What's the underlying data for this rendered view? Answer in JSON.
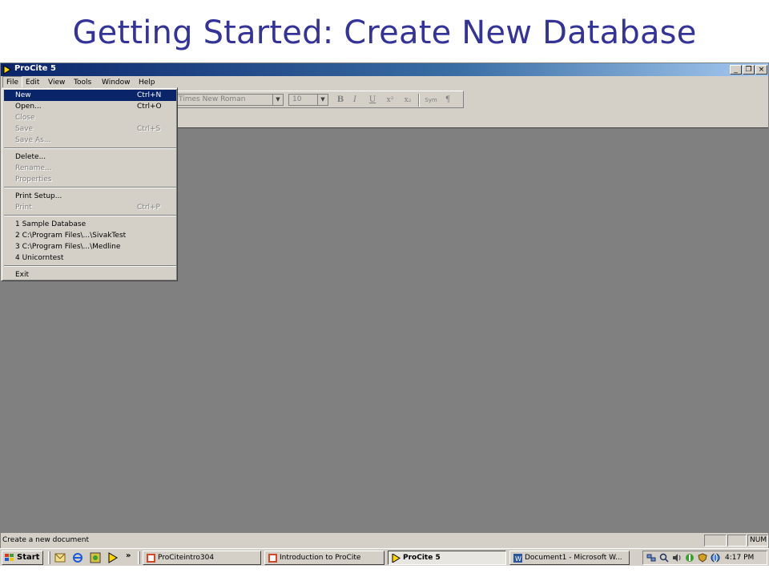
{
  "slide": {
    "title": "Getting Started: Create New Database"
  },
  "window": {
    "title": "ProCite 5",
    "controls": {
      "minimize": "_",
      "restore": "❐",
      "close": "×"
    }
  },
  "menubar": {
    "items": [
      {
        "label": "File"
      },
      {
        "label": "Edit"
      },
      {
        "label": "View"
      },
      {
        "label": "Tools"
      },
      {
        "label": "Window"
      },
      {
        "label": "Help"
      }
    ]
  },
  "format_toolbar": {
    "font_name": "Times New Roman",
    "font_size": "10",
    "bold": "B",
    "italic": "I",
    "underline": "U",
    "superscript": "x²",
    "subscript": "x₂",
    "symbol": "Sym",
    "paragraph": "¶"
  },
  "file_menu": {
    "items": [
      {
        "label": "New",
        "shortcut": "Ctrl+N"
      },
      {
        "label": "Open...",
        "shortcut": "Ctrl+O"
      },
      {
        "label": "Close",
        "shortcut": ""
      },
      {
        "label": "Save",
        "shortcut": "Ctrl+S"
      },
      {
        "label": "Save As...",
        "shortcut": ""
      },
      {
        "label": "Delete...",
        "shortcut": ""
      },
      {
        "label": "Rename...",
        "shortcut": ""
      },
      {
        "label": "Properties",
        "shortcut": ""
      },
      {
        "label": "Print Setup...",
        "shortcut": ""
      },
      {
        "label": "Print",
        "shortcut": "Ctrl+P"
      },
      {
        "label": "1 Sample Database",
        "shortcut": ""
      },
      {
        "label": "2 C:\\Program Files\\...\\SivakTest",
        "shortcut": ""
      },
      {
        "label": "3 C:\\Program Files\\...\\Medline",
        "shortcut": ""
      },
      {
        "label": "4 Unicorntest",
        "shortcut": ""
      },
      {
        "label": "Exit",
        "shortcut": ""
      }
    ]
  },
  "statusbar": {
    "message": "Create a new document",
    "num": "NUM"
  },
  "taskbar": {
    "start": "Start",
    "more": "»",
    "tasks": [
      {
        "label": "ProCiteintro304"
      },
      {
        "label": "Introduction to ProCite"
      },
      {
        "label": "ProCite 5"
      },
      {
        "label": "Document1 - Microsoft W..."
      }
    ],
    "clock": "4:17 PM"
  }
}
